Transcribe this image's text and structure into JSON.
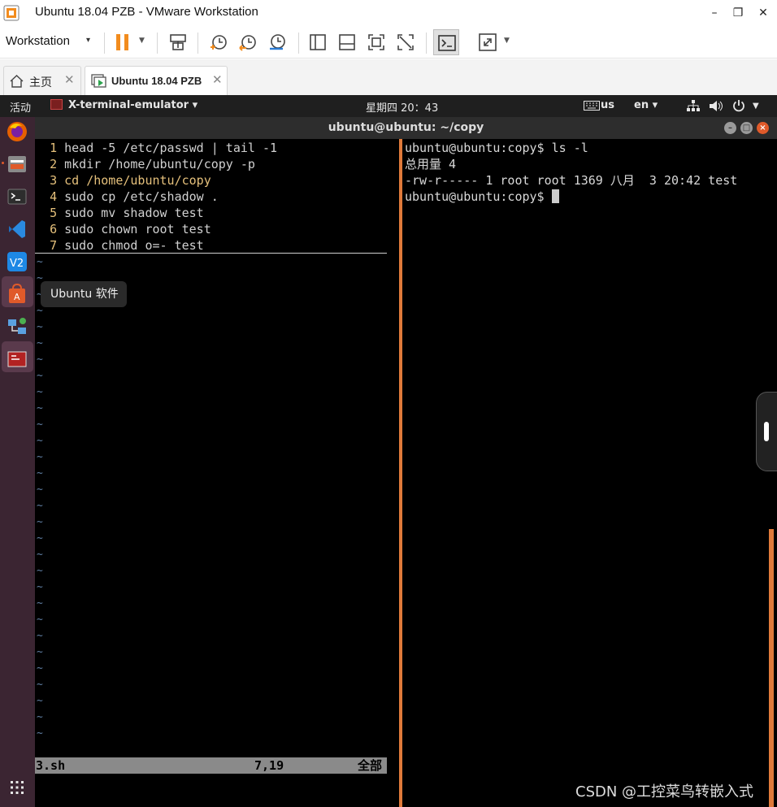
{
  "window": {
    "title": "Ubuntu 18.04 PZB - VMware Workstation",
    "minimize": "–",
    "restore": "❐",
    "close": "✕"
  },
  "toolbar": {
    "workstation_menu": "Workstation",
    "caret": "▾"
  },
  "tabs": [
    {
      "label": "主页",
      "close": "✕"
    },
    {
      "label": "Ubuntu 18.04 PZB",
      "close": "✕"
    }
  ],
  "ubuntu_topbar": {
    "activities": "活动",
    "app_name": "X-terminal-emulator ▾",
    "clock": "星期四 20：43",
    "keyboard": "us",
    "input_lang": "en ▾"
  },
  "dock": {
    "tooltip": "Ubuntu 软件",
    "items": [
      "firefox-icon",
      "files-icon",
      "terminal-icon",
      "vscode-icon",
      "v2ray-icon",
      "ubuntu-software-icon",
      "network-tool-icon",
      "terminal-emulator-icon"
    ]
  },
  "terminal": {
    "title": "ubuntu@ubuntu: ~/copy",
    "vim_lines": [
      {
        "num": "1",
        "text": "head -5 /etc/passwd | tail -1"
      },
      {
        "num": "2",
        "text": "mkdir /home/ubuntu/copy -p"
      },
      {
        "num": "3",
        "text": "cd /home/ubuntu/copy"
      },
      {
        "num": "4",
        "text": "sudo cp /etc/shadow ."
      },
      {
        "num": "5",
        "text": "sudo mv shadow test"
      },
      {
        "num": "6",
        "text": "sudo chown root test"
      },
      {
        "num": "7",
        "text": "sudo chmod o=- test"
      }
    ],
    "tilde": "~",
    "status_file": "3.sh",
    "status_pos": "7,19",
    "status_all": "全部",
    "shell_lines": [
      "ubuntu@ubuntu:copy$ ls -l",
      "总用量 4",
      "-rw-r----- 1 root root 1369 八月  3 20:42 test"
    ],
    "shell_prompt": "ubuntu@ubuntu:copy$ "
  },
  "watermark": "CSDN @工控菜鸟转嵌入式",
  "colors": {
    "divider": "#e07a3a",
    "dock_bg": "#3b2532",
    "vim_line_number": "#e5c07b",
    "vim_tilde": "#5f7ea3"
  }
}
